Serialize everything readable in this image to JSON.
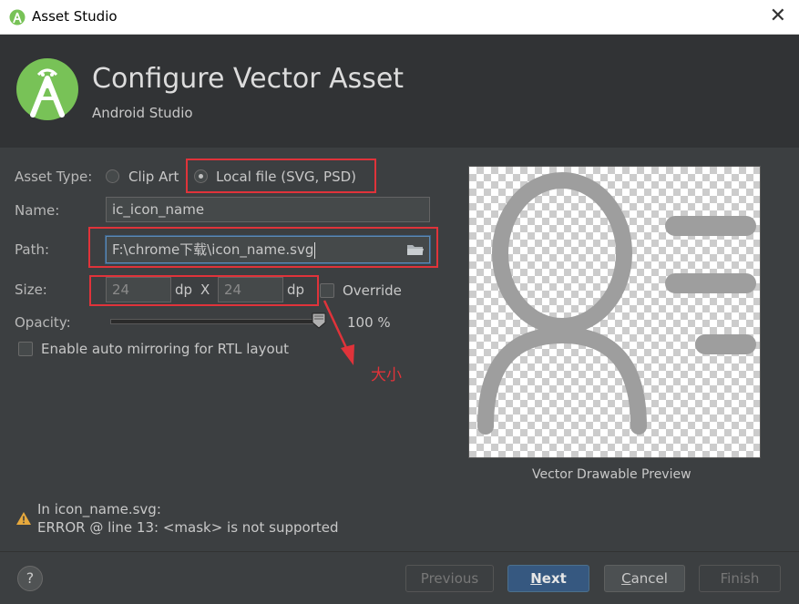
{
  "window": {
    "title": "Asset Studio",
    "close_glyph": "✕"
  },
  "header": {
    "title": "Configure Vector Asset",
    "subtitle": "Android Studio"
  },
  "form": {
    "asset_type_label": "Asset Type:",
    "clip_art_label": "Clip Art",
    "local_file_label": "Local file (SVG, PSD)",
    "name_label": "Name:",
    "name_value": "ic_icon_name",
    "path_label": "Path:",
    "path_value": "F:\\chrome下载\\icon_name.svg",
    "size_label": "Size:",
    "width_value": "24",
    "height_value": "24",
    "dp_unit": "dp",
    "x_sep": "X",
    "override_label": "Override",
    "opacity_label": "Opacity:",
    "opacity_value": "100 %",
    "opacity_level": 1.0,
    "auto_mirror_label": "Enable auto mirroring for RTL layout"
  },
  "annotation": {
    "text": "大小",
    "color": "#e0333a"
  },
  "preview": {
    "caption": "Vector Drawable Preview"
  },
  "error": {
    "line1": "In icon_name.svg:",
    "line2": "ERROR @ line 13: <mask> is not supported"
  },
  "buttons": {
    "help": "?",
    "previous": "Previous",
    "next_prefix": "N",
    "next_rest": "ext",
    "cancel_prefix": "C",
    "cancel_rest": "ancel",
    "finish": "Finish"
  },
  "colors": {
    "accent": "#365880",
    "highlight": "#e0333a",
    "android_green": "#a4c639"
  }
}
